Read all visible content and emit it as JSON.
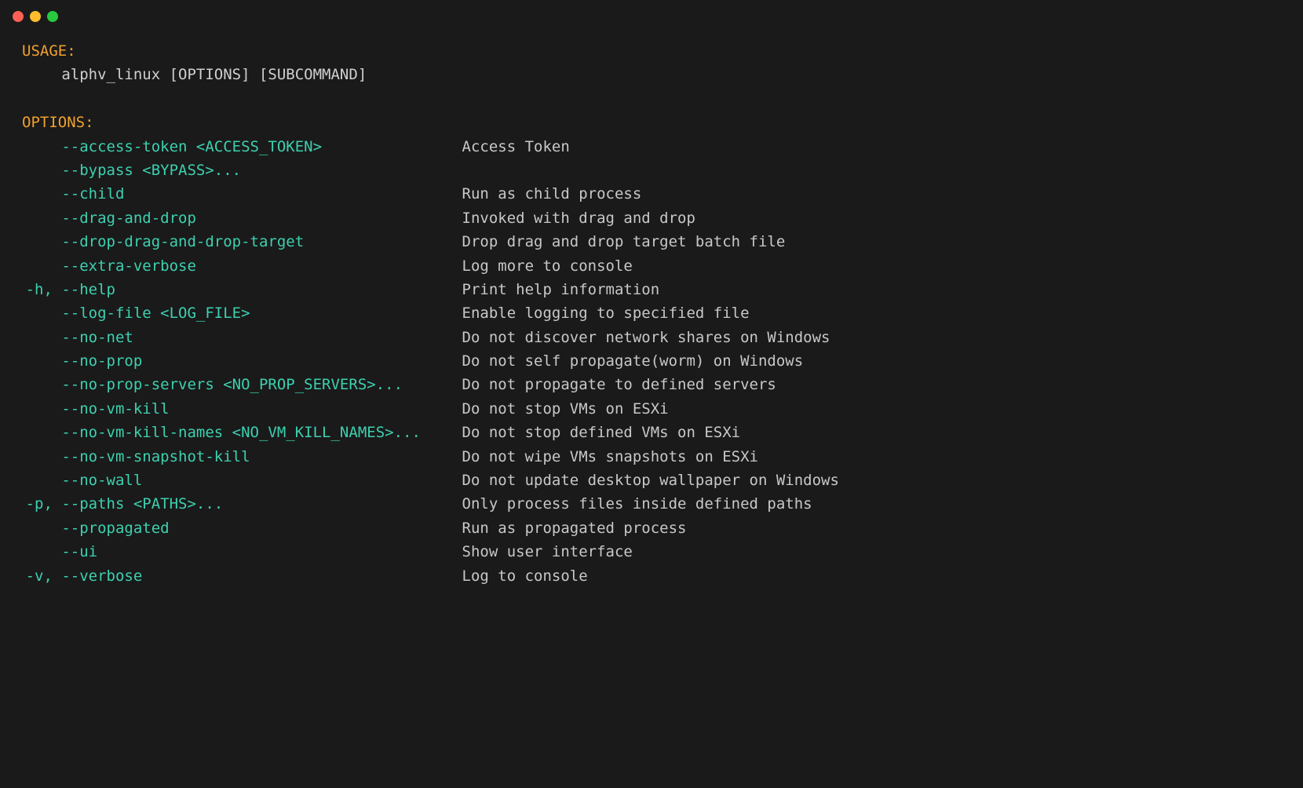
{
  "usage": {
    "header": "USAGE:",
    "line": "alphv_linux [OPTIONS] [SUBCOMMAND]"
  },
  "options_header": "OPTIONS:",
  "options": [
    {
      "short": "    ",
      "flag": "--access-token <ACCESS_TOKEN>",
      "desc": "Access Token"
    },
    {
      "short": "    ",
      "flag": "--bypass <BYPASS>...",
      "desc": ""
    },
    {
      "short": "    ",
      "flag": "--child",
      "desc": "Run as child process"
    },
    {
      "short": "    ",
      "flag": "--drag-and-drop",
      "desc": "Invoked with drag and drop"
    },
    {
      "short": "    ",
      "flag": "--drop-drag-and-drop-target",
      "desc": "Drop drag and drop target batch file"
    },
    {
      "short": "    ",
      "flag": "--extra-verbose",
      "desc": "Log more to console"
    },
    {
      "short": "-h, ",
      "flag": "--help",
      "desc": "Print help information"
    },
    {
      "short": "    ",
      "flag": "--log-file <LOG_FILE>",
      "desc": "Enable logging to specified file"
    },
    {
      "short": "    ",
      "flag": "--no-net",
      "desc": "Do not discover network shares on Windows"
    },
    {
      "short": "    ",
      "flag": "--no-prop",
      "desc": "Do not self propagate(worm) on Windows"
    },
    {
      "short": "    ",
      "flag": "--no-prop-servers <NO_PROP_SERVERS>...",
      "desc": "Do not propagate to defined servers"
    },
    {
      "short": "    ",
      "flag": "--no-vm-kill",
      "desc": "Do not stop VMs on ESXi"
    },
    {
      "short": "    ",
      "flag": "--no-vm-kill-names <NO_VM_KILL_NAMES>...",
      "desc": "Do not stop defined VMs on ESXi"
    },
    {
      "short": "    ",
      "flag": "--no-vm-snapshot-kill",
      "desc": "Do not wipe VMs snapshots on ESXi"
    },
    {
      "short": "    ",
      "flag": "--no-wall",
      "desc": "Do not update desktop wallpaper on Windows"
    },
    {
      "short": "-p, ",
      "flag": "--paths <PATHS>...",
      "desc": "Only process files inside defined paths"
    },
    {
      "short": "    ",
      "flag": "--propagated",
      "desc": "Run as propagated process"
    },
    {
      "short": "    ",
      "flag": "--ui",
      "desc": "Show user interface"
    },
    {
      "short": "-v, ",
      "flag": "--verbose",
      "desc": "Log to console"
    }
  ]
}
